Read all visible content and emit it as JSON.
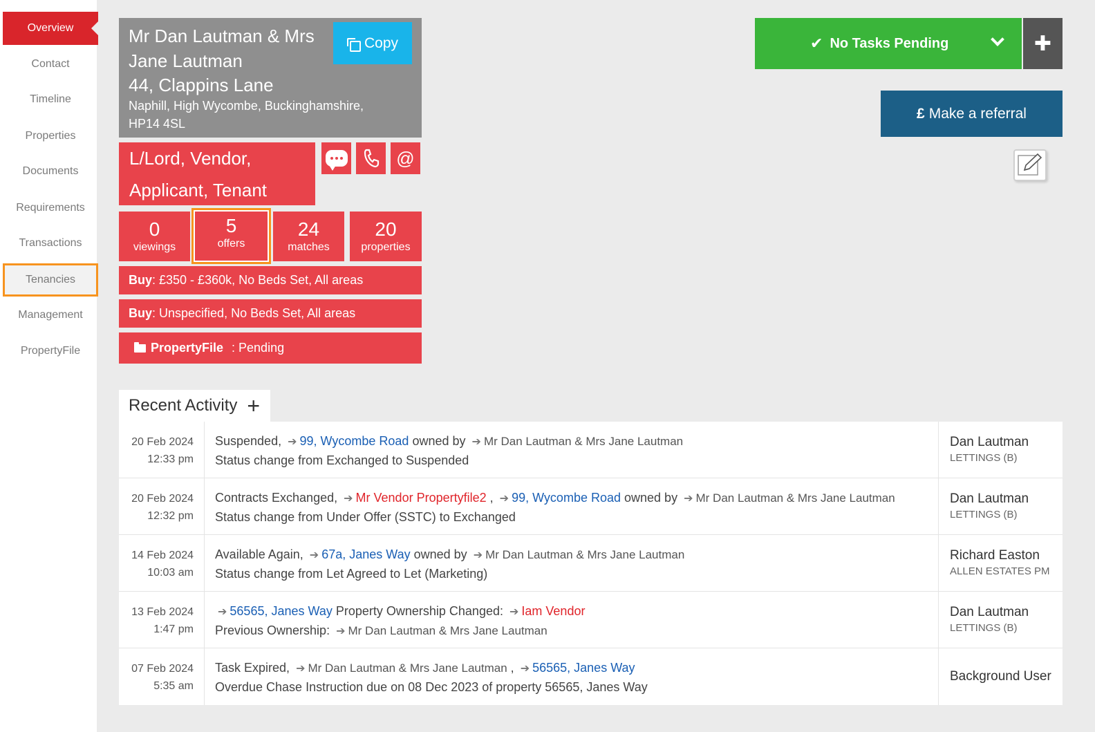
{
  "sidebar": {
    "items": [
      {
        "label": "Overview"
      },
      {
        "label": "Contact"
      },
      {
        "label": "Timeline"
      },
      {
        "label": "Properties"
      },
      {
        "label": "Documents"
      },
      {
        "label": "Requirements"
      },
      {
        "label": "Transactions"
      },
      {
        "label": "Tenancies"
      },
      {
        "label": "Management"
      },
      {
        "label": "PropertyFile"
      }
    ]
  },
  "contact": {
    "name": "Mr Dan Lautman & Mrs Jane Lautman",
    "address_line1": "44, Clappins Lane",
    "address_line2": "Naphill, High Wycombe, Buckinghamshire, HP14 4SL",
    "copy_label": "Copy",
    "roles": "L/Lord, Vendor, Applicant, Tenant"
  },
  "stats": [
    {
      "num": "0",
      "label": "viewings"
    },
    {
      "num": "5",
      "label": "offers"
    },
    {
      "num": "24",
      "label": "matches"
    },
    {
      "num": "20",
      "label": "properties"
    }
  ],
  "requirements": [
    {
      "type": "Buy",
      "detail": ": £350 - £360k, No Beds Set, All areas"
    },
    {
      "type": "Buy",
      "detail": ": Unspecified, No Beds Set, All areas"
    }
  ],
  "propertyfile": {
    "brand": "PropertyFile",
    "status": ": Pending"
  },
  "actions": {
    "tasks_label": "No Tasks Pending",
    "referral_symbol": "£",
    "referral_label": "Make a referral"
  },
  "recent_activity": {
    "title": "Recent Activity",
    "rows": [
      {
        "date": "20 Feb 2024",
        "time": "12:33 pm",
        "event": "Suspended,",
        "link1": "99, Wycombe Road",
        "owned_by": "owned by",
        "person": "Mr Dan Lautman & Mrs Jane Lautman",
        "line2": "Status change from Exchanged to Suspended",
        "user": "Dan Lautman",
        "team": "LETTINGS (B)"
      },
      {
        "date": "20 Feb 2024",
        "time": "12:32 pm",
        "event": "Contracts Exchanged,",
        "vendor": "Mr Vendor Propertyfile2",
        "comma": ",",
        "link1": "99, Wycombe Road",
        "owned_by": "owned by",
        "person": "Mr Dan Lautman & Mrs Jane Lautman",
        "line2": "Status change from Under Offer (SSTC) to Exchanged",
        "user": "Dan Lautman",
        "team": "LETTINGS (B)"
      },
      {
        "date": "14 Feb 2024",
        "time": "10:03 am",
        "event": "Available Again,",
        "link1": "67a, Janes Way",
        "owned_by": "owned by",
        "person": "Mr Dan Lautman & Mrs Jane Lautman",
        "line2": "Status change from Let Agreed to Let (Marketing)",
        "user": "Richard Easton",
        "team": "ALLEN ESTATES PM"
      },
      {
        "date": "13 Feb 2024",
        "time": "1:47 pm",
        "link1": "56565, Janes Way",
        "event": "Property Ownership Changed:",
        "vendor": "Iam Vendor",
        "line2": "Previous Ownership:",
        "person": "Mr Dan Lautman & Mrs Jane Lautman",
        "user": "Dan Lautman",
        "team": "LETTINGS (B)"
      },
      {
        "date": "07 Feb 2024",
        "time": "5:35 am",
        "event": "Task Expired,",
        "person": "Mr Dan Lautman & Mrs Jane Lautman",
        "comma": ",",
        "link1": "56565, Janes Way",
        "line2": "Overdue Chase Instruction due on 08 Dec 2023 of property 56565, Janes Way",
        "user": "Background User",
        "team": ""
      }
    ]
  },
  "colors": {
    "brand_red": "#e8434b",
    "active_red": "#d9252b",
    "copy_blue": "#19b4ea",
    "tasks_green": "#3ab53a",
    "referral_blue": "#1c5f87",
    "highlight_orange": "#f7931e",
    "link_blue": "#1a5fb4"
  }
}
